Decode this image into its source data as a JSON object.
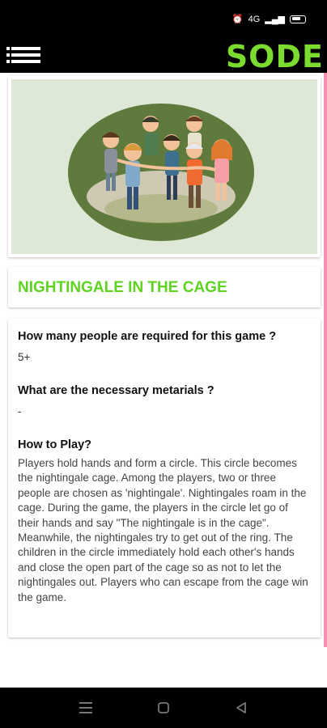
{
  "status": {
    "icons": [
      "alarm-icon",
      "data-icon",
      "signal-icon",
      "battery-icon"
    ],
    "network": "4G"
  },
  "app": {
    "brand": "SODE",
    "brand_color": "#7cdb2f"
  },
  "game": {
    "title": "NIGHTINGALE IN THE CAGE",
    "q1": "How many people are required for this game ?",
    "a1": "5+",
    "q2": "What are the necessary metarials ?",
    "a2": "-",
    "q3": "How to Play?",
    "description": "Players hold hands and form a circle. This circle becomes the nightingale cage. Among the players, two or three people are chosen as 'nightingale'. Nightingales roam in the cage. During the game, the players in the circle let go of their hands and say \"The nightingale is in the cage\". Meanwhile, the nightingales try to get out of the ring. The children in the circle immediately hold each other's hands and close the open part of the cage so as not to let the nightingales out. Players who can escape from the cage win the game."
  },
  "nav": {
    "buttons": [
      "menu",
      "home",
      "back"
    ]
  }
}
